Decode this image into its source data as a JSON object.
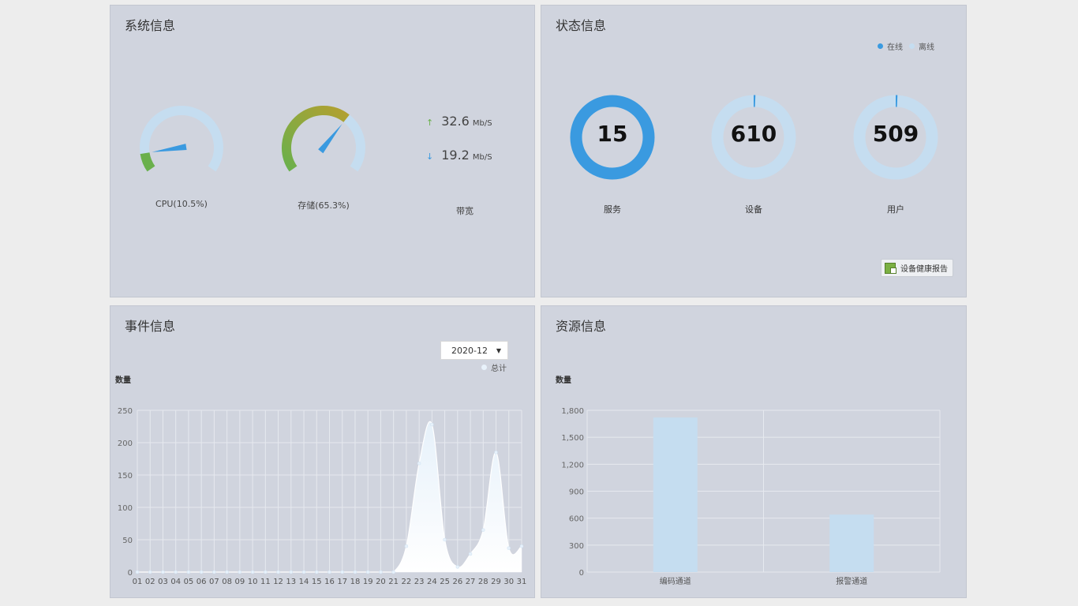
{
  "panels": {
    "system": {
      "title": "系统信息"
    },
    "status": {
      "title": "状态信息"
    },
    "event": {
      "title": "事件信息"
    },
    "resource": {
      "title": "资源信息"
    }
  },
  "system": {
    "cpu": {
      "label": "CPU(10.5%)",
      "percent": 10.5
    },
    "storage": {
      "label": "存储(65.3%)",
      "percent": 65.3
    },
    "bandwidth": {
      "up_value": "32.6",
      "down_value": "19.2",
      "unit": "Mb/S",
      "label": "带宽",
      "up_color": "#6ab04c",
      "down_color": "#3a9ae0"
    }
  },
  "status": {
    "legend": {
      "online": "在线",
      "offline": "离线",
      "online_color": "#3a9ae0",
      "offline_color": "#c5ddf0"
    },
    "rings": [
      {
        "value": "15",
        "label": "服务",
        "online_fraction": 1.0
      },
      {
        "value": "610",
        "label": "设备",
        "online_fraction": 0.004
      },
      {
        "value": "509",
        "label": "用户",
        "online_fraction": 0.002
      }
    ],
    "report_button": "设备健康报告"
  },
  "event": {
    "select_value": "2020-12",
    "legend": "总计",
    "ylabel": "数量"
  },
  "resource": {
    "ylabel": "数量"
  },
  "chart_data": [
    {
      "type": "area",
      "title": "",
      "ylabel": "数量",
      "ylim": [
        0,
        250
      ],
      "yticks": [
        0,
        50,
        100,
        150,
        200,
        250
      ],
      "categories": [
        "01",
        "02",
        "03",
        "04",
        "05",
        "06",
        "07",
        "08",
        "09",
        "10",
        "11",
        "12",
        "13",
        "14",
        "15",
        "16",
        "17",
        "18",
        "19",
        "20",
        "21",
        "22",
        "23",
        "24",
        "25",
        "26",
        "27",
        "28",
        "29",
        "30",
        "31"
      ],
      "series": [
        {
          "name": "总计",
          "values": [
            0,
            0,
            0,
            0,
            0,
            0,
            0,
            0,
            0,
            0,
            0,
            0,
            0,
            0,
            0,
            0,
            0,
            0,
            0,
            0,
            0,
            40,
            168,
            228,
            50,
            8,
            28,
            65,
            185,
            37,
            40
          ]
        }
      ],
      "grid": true,
      "legend_position": "top-right"
    },
    {
      "type": "bar",
      "title": "",
      "ylabel": "数量",
      "ylim": [
        0,
        1800
      ],
      "yticks": [
        "0",
        "300",
        "600",
        "900",
        "1,200",
        "1,500",
        "1,800"
      ],
      "categories": [
        "编码通道",
        "报警通道"
      ],
      "values": [
        1720,
        640
      ],
      "grid": true
    }
  ]
}
